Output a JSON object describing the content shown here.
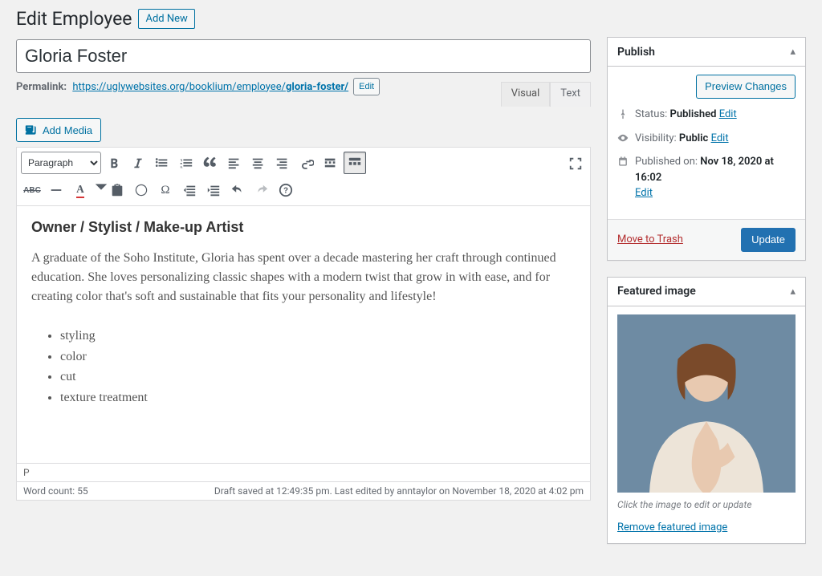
{
  "heading": {
    "title": "Edit Employee",
    "add_new": "Add New"
  },
  "post": {
    "title": "Gloria Foster",
    "permalink_label": "Permalink:",
    "permalink_base": "https://uglywebsites.org/booklium/employee/",
    "permalink_slug": "gloria-foster/",
    "edit_btn": "Edit"
  },
  "media_button": "Add Media",
  "editor_tabs": {
    "visual": "Visual",
    "text": "Text"
  },
  "toolbar": {
    "format_select": "Paragraph"
  },
  "content": {
    "heading": "Owner / Stylist / Make-up Artist",
    "paragraph": "A graduate of the Soho Institute, Gloria has spent over a decade mastering her craft through continued education. She loves personalizing classic shapes with a modern twist that grow in with ease, and for creating color that's soft and sustainable that fits your personality and lifestyle!",
    "list": [
      "styling",
      "color",
      "cut",
      "texture treatment"
    ]
  },
  "status_bar": {
    "path": "P",
    "word_count_label": "Word count: ",
    "word_count": "55",
    "draft_info": "Draft saved at 12:49:35 pm. Last edited by anntaylor on November 18, 2020 at 4:02 pm"
  },
  "publish": {
    "box_title": "Publish",
    "preview_btn": "Preview Changes",
    "status_label": "Status: ",
    "status_value": "Published",
    "visibility_label": "Visibility: ",
    "visibility_value": "Public",
    "published_label": "Published on: ",
    "published_value": "Nov 18, 2020 at 16:02",
    "edit": "Edit",
    "trash": "Move to Trash",
    "update_btn": "Update"
  },
  "featured": {
    "box_title": "Featured image",
    "caption": "Click the image to edit or update",
    "remove": "Remove featured image"
  }
}
